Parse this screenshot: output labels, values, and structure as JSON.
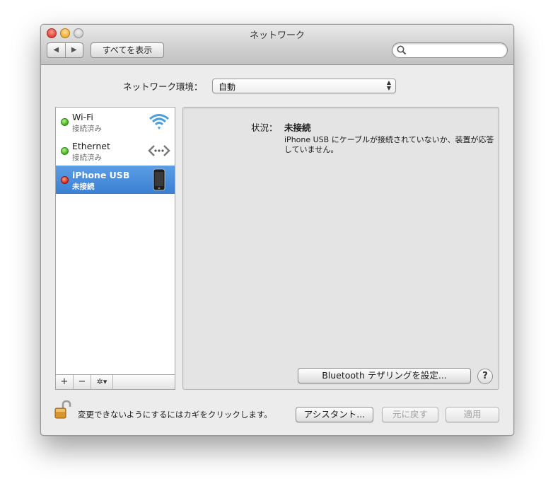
{
  "window": {
    "title": "ネットワーク",
    "nav_back": "◀",
    "nav_forward": "▶",
    "show_all": "すべてを表示",
    "search_placeholder": ""
  },
  "location": {
    "label": "ネットワーク環境：",
    "value": "自動"
  },
  "services": [
    {
      "name": "Wi-Fi",
      "status": "接続済み",
      "status_color": "green",
      "icon": "wifi-icon"
    },
    {
      "name": "Ethernet",
      "status": "接続済み",
      "status_color": "green",
      "icon": "ethernet-icon"
    },
    {
      "name": "iPhone USB",
      "status": "未接続",
      "status_color": "red",
      "icon": "iphone-icon",
      "selected": true
    }
  ],
  "sidebar_tools": {
    "add": "+",
    "remove": "−",
    "gear": "✲▾"
  },
  "detail": {
    "status_label": "状況：",
    "status_value": "未接続",
    "status_description": "iPhone USB にケーブルが接続されていないか、装置が応答していません。",
    "bluetooth_button": "Bluetooth テザリングを設定...",
    "help": "?"
  },
  "footer": {
    "lock_text": "変更できないようにするにはカギをクリックします。",
    "assistant": "アシスタント...",
    "revert": "元に戻す",
    "apply": "適用"
  },
  "colors": {
    "selection": "#3a7fd3",
    "connected": "#3fae1c",
    "disconnected": "#d12a1c"
  }
}
